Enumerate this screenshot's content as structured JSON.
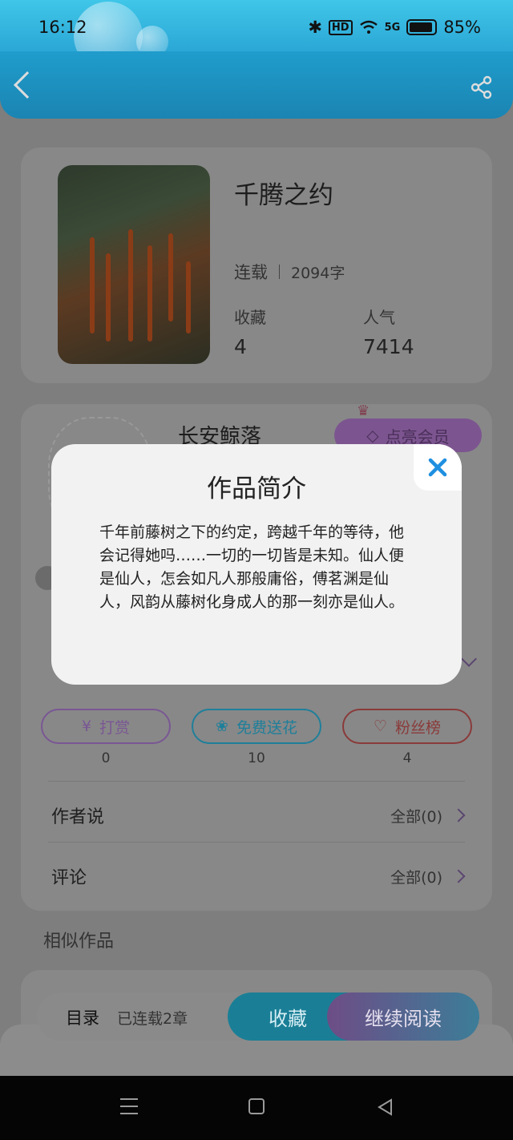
{
  "status_bar": {
    "time": "16:12",
    "hd": "HD",
    "network": "5G",
    "battery": "85%"
  },
  "book": {
    "title": "千腾之约",
    "status": "连载",
    "word_count": "2094字",
    "favorites_label": "收藏",
    "favorites_value": "4",
    "popularity_label": "人气",
    "popularity_value": "7414"
  },
  "author": {
    "name": "长安鲸落",
    "vip_button": "点亮会员"
  },
  "actions": [
    {
      "label": "打赏",
      "count": "0",
      "color": "#7a5794"
    },
    {
      "label": "免费送花",
      "count": "10",
      "color": "#1f7f9a"
    },
    {
      "label": "粉丝榜",
      "count": "4",
      "color": "#8a3a3a"
    }
  ],
  "rows": [
    {
      "label": "作者说",
      "right": "全部(0)"
    },
    {
      "label": "评论",
      "right": "全部(0)"
    }
  ],
  "similar_title": "相似作品",
  "bottom_bar": {
    "toc": "目录",
    "serial": "已连载2章",
    "favorite": "收藏",
    "continue": "继续阅读"
  },
  "modal": {
    "title": "作品简介",
    "body": "千年前藤树之下的约定，跨越千年的等待，他会记得她吗……一切的一切皆是未知。仙人便是仙人，怎会如凡人那般庸俗，傅茗渊是仙人，风韵从藤树化身成人的那一刻亦是仙人。"
  },
  "colors": {
    "accent_blue": "#1e9dd8",
    "accent_purple": "#8e6bb4",
    "close_icon": "#1e8fe0"
  }
}
